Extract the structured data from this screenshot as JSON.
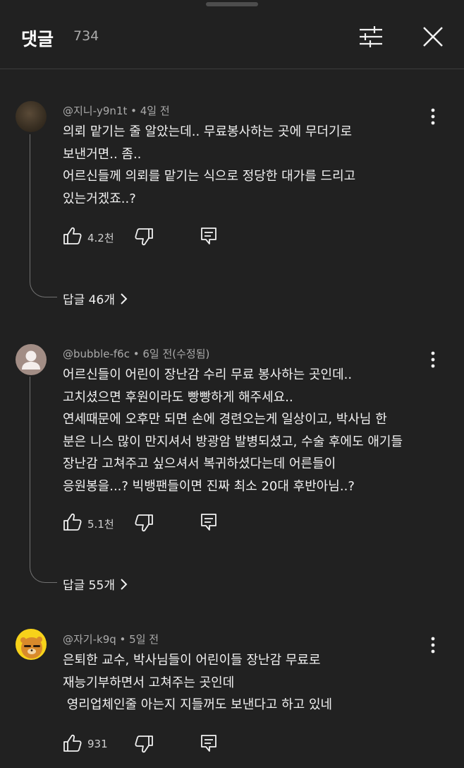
{
  "header": {
    "title": "댓글",
    "count": "734"
  },
  "comments": [
    {
      "author": "@지니-y9n1t",
      "time": "4일 전",
      "lines": [
        "의뢰 맡기는 줄 알았는데.. 무료봉사하는 곳에 무더기로",
        "보낸거면.. 좀..",
        "어르신들께 의뢰를 맡기는 식으로 정당한 대가를 드리고",
        "있는거겠죠..?"
      ],
      "likes": "4.2천",
      "replies": "답글 46개"
    },
    {
      "author": "@bubble-f6c",
      "time": "6일 전(수정됨)",
      "lines": [
        "어르신들이 어린이 장난감 수리 무료 봉사하는 곳인데..",
        "고치셨으면 후원이라도 빵빵하게 해주세요..",
        "연세때문에 오후만 되면 손에 경련오는게 일상이고, 박사님 한",
        "분은 니스 많이 만지셔서 방광암 발병되셨고, 수술 후에도 애기들",
        "장난감 고쳐주고 싶으셔서 복귀하셨다는데 어른들이",
        "응원봉을...? 빅뱅팬들이면 진짜 최소 20대 후반아님..?"
      ],
      "likes": "5.1천",
      "replies": "답글 55개"
    },
    {
      "author": "@자기-k9q",
      "time": "5일 전",
      "lines": [
        "은퇴한 교수, 박사님들이 어린이들 장난감 무료로",
        "재능기부하면서 고쳐주는 곳인데",
        " 영리업체인줄 아는지 지들꺼도 보낸다고 하고 있네"
      ],
      "likes": "931"
    }
  ]
}
